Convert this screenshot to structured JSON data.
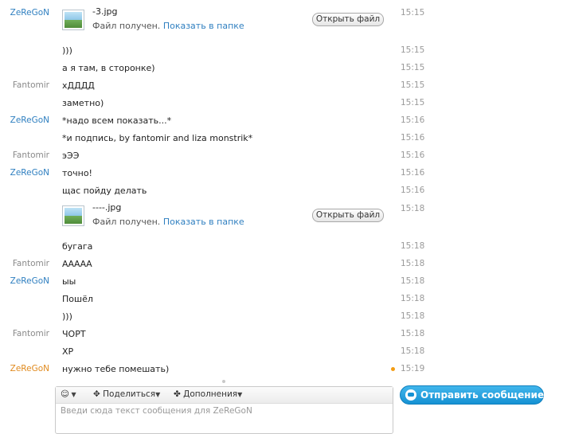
{
  "colors": {
    "me": "#2f7fc0",
    "other": "#8a8a8a",
    "unread": "#f39c12",
    "send_button": "#1b9ad9"
  },
  "icons": {
    "file_thumb": "image-thumbnail-icon",
    "emoji": "smiley-icon",
    "share": "share-icon",
    "addons": "puzzle-icon",
    "send": "chat-bubble-icon",
    "unread": "unread-dot-icon"
  },
  "messages": [
    {
      "sender": "ZeReGoN",
      "type": "file",
      "file_name": "-3.jpg",
      "status": "Файл получен.",
      "link": "Показать в папке",
      "button": "Открыть файл",
      "time": "15:15"
    },
    {
      "sender": "",
      "text": ")))",
      "time": "15:15"
    },
    {
      "sender": "",
      "text": "а я там, в сторонке)",
      "time": "15:15"
    },
    {
      "sender": "Fantomir",
      "text": "хДДДД",
      "time": "15:15"
    },
    {
      "sender": "",
      "text": "заметно)",
      "time": "15:15"
    },
    {
      "sender": "ZeReGoN",
      "text": "*надо всем показать...*",
      "time": "15:16"
    },
    {
      "sender": "",
      "text": "*и подпись, by fantomir and liza monstrik*",
      "time": "15:16"
    },
    {
      "sender": "Fantomir",
      "text": "эЭЭ",
      "time": "15:16"
    },
    {
      "sender": "ZeReGoN",
      "text": "точно!",
      "time": "15:16"
    },
    {
      "sender": "",
      "text": "щас пойду делать",
      "time": "15:16"
    },
    {
      "sender": "",
      "type": "file",
      "file_name": "----.jpg",
      "status": "Файл получен.",
      "link": "Показать в папке",
      "button": "Открыть файл",
      "time": "15:18"
    },
    {
      "sender": "",
      "text": "бугага",
      "time": "15:18"
    },
    {
      "sender": "Fantomir",
      "text": "ААААА",
      "time": "15:18"
    },
    {
      "sender": "ZeReGoN",
      "text": "ыы",
      "time": "15:18"
    },
    {
      "sender": "",
      "text": "Пошёл",
      "time": "15:18"
    },
    {
      "sender": "",
      "text": ")))",
      "time": "15:18"
    },
    {
      "sender": "Fantomir",
      "text": "ЧОРТ",
      "time": "15:18"
    },
    {
      "sender": "",
      "text": "ХР",
      "time": "15:18"
    },
    {
      "sender": "ZeReGoN",
      "text": "нужно тебе помешать)",
      "time": "15:19",
      "unread": true
    }
  ],
  "composer": {
    "share_label": "Поделиться",
    "addons_label": "Дополнения",
    "placeholder": "Введи сюда текст сообщения для ZeReGoN"
  },
  "send_button_label": "Отправить сообщение"
}
